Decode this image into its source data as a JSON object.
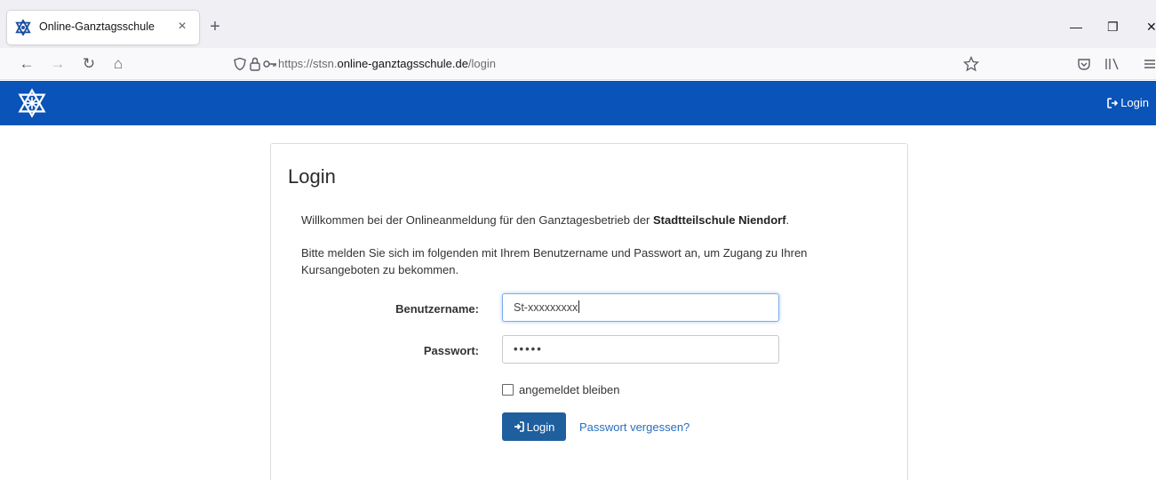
{
  "browser": {
    "tab": {
      "title": "Online-Ganztagsschule",
      "close_icon": "×",
      "favicon": "school-star-logo"
    },
    "new_tab_icon": "+",
    "window_controls": {
      "minimize": "—",
      "restore": "❐",
      "close": "✕"
    },
    "nav": {
      "back_icon": "←",
      "forward_icon": "→",
      "reload_icon": "↻",
      "home_icon": "⌂"
    },
    "url": {
      "prefix": "https://stsn.",
      "host": "online-ganztagsschule.de",
      "path": "/login"
    },
    "toolbar_icons": [
      "bookmark-star-icon",
      "pocket-icon",
      "library-icon",
      "menu-icon"
    ]
  },
  "site": {
    "brand_color": "#0a53b8",
    "header_login_label": "Login"
  },
  "login": {
    "title": "Login",
    "welcome_prefix": "Willkommen bei der Onlineanmeldung für den Ganztagesbetrieb der ",
    "welcome_school": "Stadtteilschule Niendorf",
    "welcome_suffix": ".",
    "instructions": "Bitte melden Sie sich im folgenden mit Ihrem Benutzername und Passwort an, um Zugang zu Ihren Kursangeboten zu bekommen.",
    "username_label": "Benutzername:",
    "username_value": "St-xxxxxxxxx",
    "password_label": "Passwort:",
    "password_value": "•••••",
    "remember_label": "angemeldet bleiben",
    "submit_label": "Login",
    "forgot_label": "Passwort vergessen?"
  }
}
